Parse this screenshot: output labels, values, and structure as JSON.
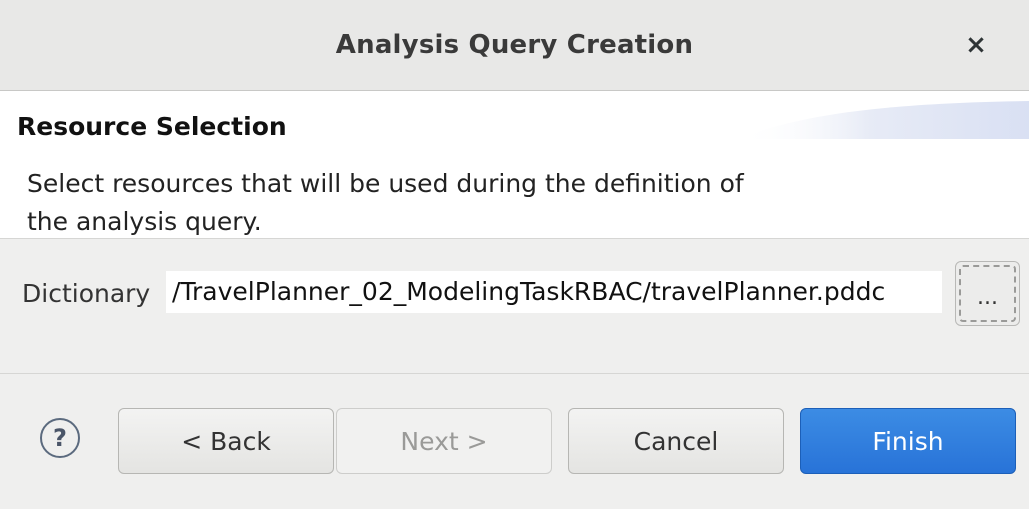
{
  "window": {
    "title": "Analysis Query Creation",
    "close_glyph": "×"
  },
  "banner": {
    "title": "Resource Selection",
    "description": "Select resources that will be used during the definition of the analysis query."
  },
  "form": {
    "dictionary_label": "Dictionary",
    "dictionary_value": "/TravelPlanner_02_ModelingTaskRBAC/travelPlanner.pddc",
    "browse_label": "..."
  },
  "footer": {
    "help_glyph": "?",
    "back_label": "< Back",
    "next_label": "Next >",
    "cancel_label": "Cancel",
    "finish_label": "Finish"
  },
  "colors": {
    "accent": "#2873d8",
    "disabled_text": "#9a9a98"
  }
}
